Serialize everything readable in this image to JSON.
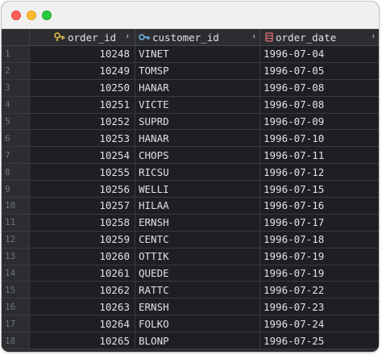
{
  "window": {
    "buttons": [
      "close",
      "minimize",
      "zoom"
    ]
  },
  "columns": [
    {
      "name": "order_id",
      "icon": "primary-key-icon",
      "icon_color": "#e5c24a"
    },
    {
      "name": "customer_id",
      "icon": "foreign-key-icon",
      "icon_color": "#6fb6e8"
    },
    {
      "name": "order_date",
      "icon": "column-date-icon",
      "icon_color": "#e0737c"
    }
  ],
  "rows": [
    {
      "n": "1",
      "order_id": "10248",
      "customer_id": "VINET",
      "order_date": "1996-07-04"
    },
    {
      "n": "2",
      "order_id": "10249",
      "customer_id": "TOMSP",
      "order_date": "1996-07-05"
    },
    {
      "n": "3",
      "order_id": "10250",
      "customer_id": "HANAR",
      "order_date": "1996-07-08"
    },
    {
      "n": "4",
      "order_id": "10251",
      "customer_id": "VICTE",
      "order_date": "1996-07-08"
    },
    {
      "n": "5",
      "order_id": "10252",
      "customer_id": "SUPRD",
      "order_date": "1996-07-09"
    },
    {
      "n": "6",
      "order_id": "10253",
      "customer_id": "HANAR",
      "order_date": "1996-07-10"
    },
    {
      "n": "7",
      "order_id": "10254",
      "customer_id": "CHOPS",
      "order_date": "1996-07-11"
    },
    {
      "n": "8",
      "order_id": "10255",
      "customer_id": "RICSU",
      "order_date": "1996-07-12"
    },
    {
      "n": "9",
      "order_id": "10256",
      "customer_id": "WELLI",
      "order_date": "1996-07-15"
    },
    {
      "n": "10",
      "order_id": "10257",
      "customer_id": "HILAA",
      "order_date": "1996-07-16"
    },
    {
      "n": "11",
      "order_id": "10258",
      "customer_id": "ERNSH",
      "order_date": "1996-07-17"
    },
    {
      "n": "12",
      "order_id": "10259",
      "customer_id": "CENTC",
      "order_date": "1996-07-18"
    },
    {
      "n": "13",
      "order_id": "10260",
      "customer_id": "OTTIK",
      "order_date": "1996-07-19"
    },
    {
      "n": "14",
      "order_id": "10261",
      "customer_id": "QUEDE",
      "order_date": "1996-07-19"
    },
    {
      "n": "15",
      "order_id": "10262",
      "customer_id": "RATTC",
      "order_date": "1996-07-22"
    },
    {
      "n": "16",
      "order_id": "10263",
      "customer_id": "ERNSH",
      "order_date": "1996-07-23"
    },
    {
      "n": "17",
      "order_id": "10264",
      "customer_id": "FOLKO",
      "order_date": "1996-07-24"
    },
    {
      "n": "18",
      "order_id": "10265",
      "customer_id": "BLONP",
      "order_date": "1996-07-25"
    }
  ]
}
